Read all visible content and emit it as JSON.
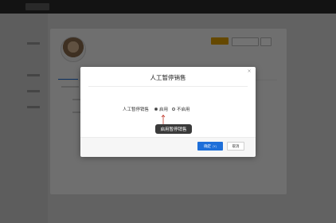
{
  "topbar": {
    "brand": "",
    "nav_item": ""
  },
  "profile": {
    "name": "",
    "sub": "",
    "tab_label": ""
  },
  "dialog": {
    "title": "人工暂停销售",
    "close_glyph": "×",
    "field_label": "人工暂停销售",
    "options": [
      {
        "label": "启用",
        "selected": true
      },
      {
        "label": "不启用",
        "selected": false
      }
    ],
    "tooltip": "启用暂停销售",
    "confirm_label": "确定",
    "confirm_hint": "(Y)",
    "cancel_label": "取消"
  },
  "colors": {
    "primary": "#1e6fd9",
    "tooltip_bg": "#3a3a3a",
    "arrow": "#c0392b",
    "accent_orange": "#e0a100"
  },
  "icons": {
    "close": "close-icon",
    "arrow": "arrow-up-icon"
  }
}
